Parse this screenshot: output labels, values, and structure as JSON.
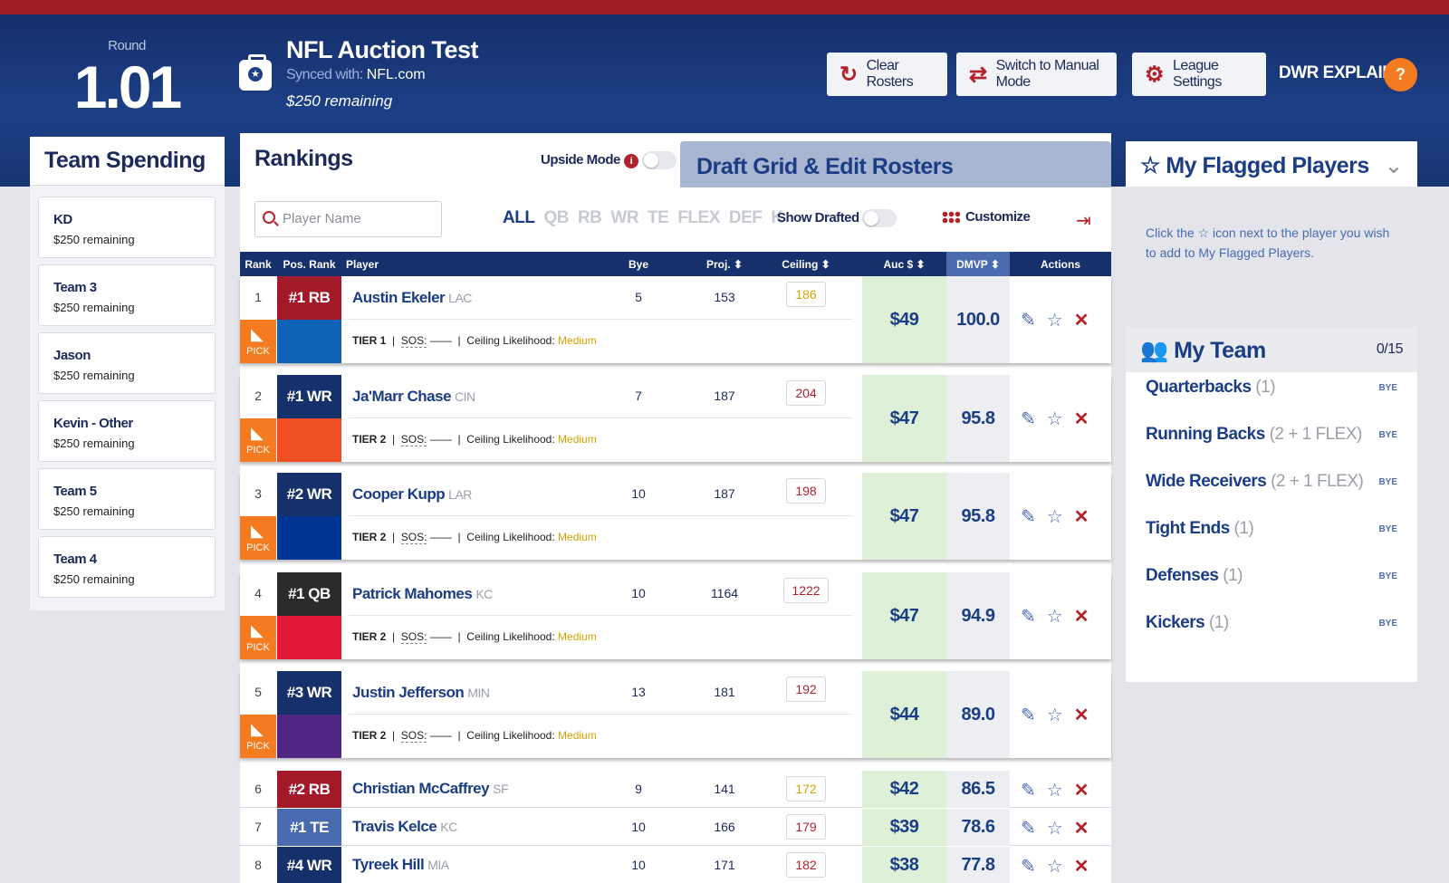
{
  "header": {
    "round_label": "Round",
    "round_value": "1.01",
    "league_title": "NFL Auction Test",
    "synced_label": "Synced with:",
    "synced_value": "NFL.com",
    "remaining": "$250 remaining",
    "buttons": {
      "clear": "Clear Rosters",
      "manual": "Switch to Manual Mode",
      "settings": "League Settings"
    },
    "dwr": "DWR EXPLAINED"
  },
  "spending": {
    "title": "Team Spending",
    "teams": [
      {
        "name": "KD",
        "remaining": "$250 remaining"
      },
      {
        "name": "Team 3",
        "remaining": "$250 remaining"
      },
      {
        "name": "Jason",
        "remaining": "$250 remaining"
      },
      {
        "name": "Kevin - Other",
        "remaining": "$250 remaining"
      },
      {
        "name": "Team 5",
        "remaining": "$250 remaining"
      },
      {
        "name": "Team 4",
        "remaining": "$250 remaining"
      }
    ]
  },
  "rankings": {
    "title": "Rankings",
    "upside_label": "Upside Mode",
    "grid_tab": "Draft Grid & Edit Rosters",
    "search_placeholder": "Player Name",
    "positions": [
      "ALL",
      "QB",
      "RB",
      "WR",
      "TE",
      "FLEX",
      "DEF",
      "K"
    ],
    "show_drafted": "Show Drafted",
    "customize": "Customize",
    "columns": {
      "rank": "Rank",
      "posrank": "Pos. Rank",
      "player": "Player",
      "bye": "Bye",
      "proj": "Proj. ⬍",
      "ceiling": "Ceiling ⬍",
      "auc": "Auc $ ⬍",
      "dmvp": "DMVP ⬍",
      "actions": "Actions"
    },
    "pick_label": "PICK",
    "tier_labels": {
      "sos": "SOS:",
      "sos_value": "——",
      "ceiling_likelihood": "Ceiling Likelihood:"
    },
    "players": [
      {
        "rank": "1",
        "posrank": "#1 RB",
        "name": "Austin Ekeler",
        "team": "LAC",
        "bye": "5",
        "proj": "153",
        "ceiling": "186",
        "auc": "$49",
        "dmvp": "100.0",
        "tier": "TIER 1",
        "likelihood": "Medium",
        "pos_color": "#a3192a",
        "ceil_color": "#d8a200"
      },
      {
        "rank": "2",
        "posrank": "#1 WR",
        "name": "Ja'Marr Chase",
        "team": "CIN",
        "bye": "7",
        "proj": "187",
        "ceiling": "204",
        "auc": "$47",
        "dmvp": "95.8",
        "tier": "TIER 2",
        "likelihood": "Medium",
        "pos_color": "#16306b",
        "ceil_color": "#b3212a"
      },
      {
        "rank": "3",
        "posrank": "#2 WR",
        "name": "Cooper Kupp",
        "team": "LAR",
        "bye": "10",
        "proj": "187",
        "ceiling": "198",
        "auc": "$47",
        "dmvp": "95.8",
        "tier": "TIER 2",
        "likelihood": "Medium",
        "pos_color": "#16306b",
        "ceil_color": "#b3212a"
      },
      {
        "rank": "4",
        "posrank": "#1 QB",
        "name": "Patrick Mahomes",
        "team": "KC",
        "bye": "10",
        "proj": "1164",
        "ceiling": "1222",
        "auc": "$47",
        "dmvp": "94.9",
        "tier": "TIER 2",
        "likelihood": "Medium",
        "pos_color": "#2b2b2b",
        "ceil_color": "#b3212a"
      },
      {
        "rank": "5",
        "posrank": "#3 WR",
        "name": "Justin Jefferson",
        "team": "MIN",
        "bye": "13",
        "proj": "181",
        "ceiling": "192",
        "auc": "$44",
        "dmvp": "89.0",
        "tier": "TIER 2",
        "likelihood": "Medium",
        "pos_color": "#16306b",
        "ceil_color": "#b3212a"
      },
      {
        "rank": "6",
        "posrank": "#2 RB",
        "name": "Christian McCaffrey",
        "team": "SF",
        "bye": "9",
        "proj": "141",
        "ceiling": "172",
        "auc": "$42",
        "dmvp": "86.5",
        "pos_color": "#a3192a",
        "ceil_color": "#d8a200"
      },
      {
        "rank": "7",
        "posrank": "#1 TE",
        "name": "Travis Kelce",
        "team": "KC",
        "bye": "10",
        "proj": "166",
        "ceiling": "179",
        "auc": "$39",
        "dmvp": "78.6",
        "pos_color": "#4a6bb0",
        "ceil_color": "#b3212a"
      },
      {
        "rank": "8",
        "posrank": "#4 WR",
        "name": "Tyreek Hill",
        "team": "MIA",
        "bye": "10",
        "proj": "171",
        "ceiling": "182",
        "auc": "$38",
        "dmvp": "77.8",
        "pos_color": "#16306b",
        "ceil_color": "#b3212a"
      }
    ]
  },
  "flagged": {
    "title": "My Flagged Players",
    "text": "Click the ☆ icon next to the player you wish to add to My Flagged Players."
  },
  "my_team": {
    "title": "My Team",
    "count": "0/15",
    "slots": [
      {
        "label": "Quarterbacks",
        "count": "(1)",
        "bye": "BYE"
      },
      {
        "label": "Running Backs",
        "count": "(2 + 1 FLEX)",
        "bye": "BYE"
      },
      {
        "label": "Wide Receivers",
        "count": "(2 + 1 FLEX)",
        "bye": "BYE"
      },
      {
        "label": "Tight Ends",
        "count": "(1)",
        "bye": "BYE"
      },
      {
        "label": "Defenses",
        "count": "(1)",
        "bye": "BYE"
      },
      {
        "label": "Kickers",
        "count": "(1)",
        "bye": "BYE"
      }
    ]
  }
}
